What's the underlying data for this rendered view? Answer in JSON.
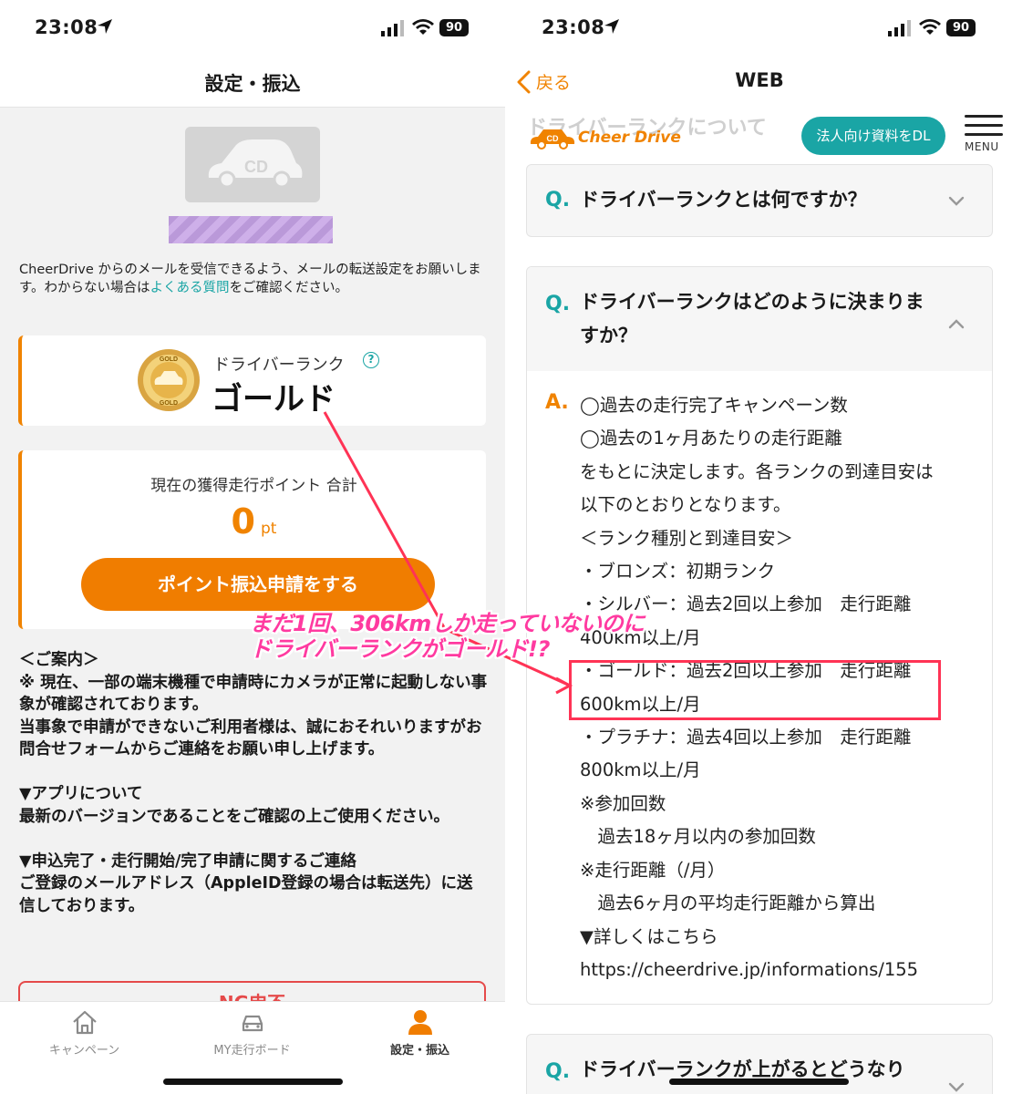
{
  "status": {
    "time": "23:08",
    "battery": "90"
  },
  "left": {
    "nav_title": "設定・振込",
    "intro_prefix": "CheerDrive からのメールを受信できるよう、メールの転送設定をお願いします。わからない場合は",
    "intro_link": "よくある質問",
    "intro_suffix": "をご確認ください。",
    "rank_label": "ドライバーランク",
    "rank_value": "ゴールド",
    "points_label": "現在の獲得走行ポイント 合計",
    "points_value": "0",
    "points_unit": "pt",
    "points_button": "ポイント振込申請をする",
    "notice": "＜ご案内＞\n※ 現在、一部の端末機種で申請時にカメラが正常に起動しない事象が確認されております。\n当事象で申請ができないご利用者様は、誠におそれいりますがお問合せフォームからご連絡をお願い申し上げます。\n\n▼アプリについて\n最新のバージョンであることをご確認の上ご使用ください。\n\n▼申込完了・走行開始/完了申請に関するご連絡\nご登録のメールアドレス（AppleID登録の場合は転送先）に送信しております。",
    "partial_button": "NG申不",
    "tabs": [
      {
        "label": "キャンペーン",
        "icon": "home-icon"
      },
      {
        "label": "MY走行ボード",
        "icon": "car-icon"
      },
      {
        "label": "設定・振込",
        "icon": "person-icon"
      }
    ]
  },
  "right": {
    "back_label": "戻る",
    "nav_title": "WEB",
    "faded_title": "ドライバーランクについて",
    "logo_text": "Cheer Drive",
    "dl_button": "法人向け資料をDL",
    "menu_label": "MENU",
    "q_mark": "Q.",
    "a_mark": "A.",
    "faq1": "ドライバーランクとは何ですか？",
    "faq2": "ドライバーランクはどのように決まりますか？",
    "faq3": "ドライバーランクが上がるとどうなり",
    "answer_lines": [
      "◯過去の走行完了キャンペーン数",
      "◯過去の1ヶ月あたりの走行距離",
      "をもとに決定します。各ランクの到達目安は",
      "以下のとおりとなります。",
      "＜ランク種別と到達目安＞",
      "・ブロンズ：初期ランク",
      "・シルバー：過去2回以上参加　走行距離",
      "400km以上/月",
      "・ゴールド：過去2回以上参加　走行距離",
      "600km以上/月",
      "・プラチナ：過去4回以上参加　走行距離",
      "800km以上/月",
      "※参加回数",
      "　過去18ヶ月以内の参加回数",
      "※走行距離（/月）",
      "　過去6ヶ月の平均走行距離から算出",
      "▼詳しくはこちら",
      "https://cheerdrive.jp/informations/155"
    ]
  },
  "annotation": {
    "line1": "まだ1回、306kmしか走っていないのに",
    "line2": "ドライバーランクがゴールド!?",
    "color": "#ff3aa0"
  },
  "colors": {
    "accent": "#f08300",
    "teal": "#1aa5a5",
    "annotation_red": "#ff3355"
  }
}
